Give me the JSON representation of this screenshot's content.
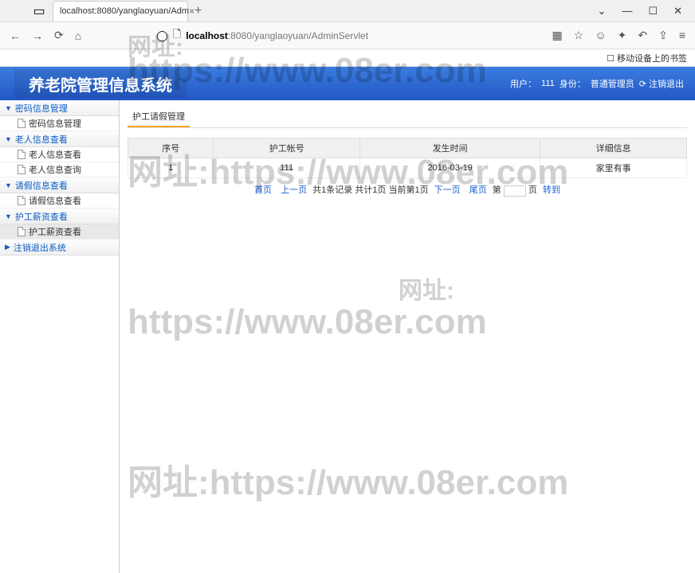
{
  "browser": {
    "tab_title": "localhost:8080/yanglaoyuan/Adm",
    "url_host": "localhost",
    "url_port": ":8080",
    "url_path": "/yanglaoyuan/AdminServlet",
    "bookmark_label": "移动设备上的书签"
  },
  "header": {
    "app_title": "养老院管理信息系统",
    "user_label": "用户：",
    "user_value": "111",
    "role_label": "身份：",
    "role_value": "普通管理员",
    "logout": "注销退出"
  },
  "sidebar": {
    "groups": [
      {
        "title": "密码信息管理",
        "items": [
          "密码信息管理"
        ]
      },
      {
        "title": "老人信息查看",
        "items": [
          "老人信息查看",
          "老人信息查询"
        ]
      },
      {
        "title": "请假信息查看",
        "items": [
          "请假信息查看"
        ]
      },
      {
        "title": "护工薪资查看",
        "items": [
          "护工薪资查看"
        ]
      },
      {
        "title": "注销退出系统",
        "items": []
      }
    ]
  },
  "main": {
    "panel_title": "护工请假管理",
    "columns": [
      "序号",
      "护工帐号",
      "发生时间",
      "详细信息"
    ],
    "rows": [
      {
        "idx": "1",
        "acct": "111",
        "date": "2016-03-19",
        "detail": "家里有事"
      }
    ],
    "pager": {
      "first": "首页",
      "prev": "上一页",
      "info": "共1条记录 共计1页 当前第1页",
      "next": "下一页",
      "last": "尾页",
      "page_label_pre": "第",
      "page_label_post": "页",
      "goto": "转到"
    }
  },
  "watermark": {
    "label": "网址:",
    "url_upper": "https://www.08er.com",
    "url": "网址:https://www.08er.com"
  }
}
